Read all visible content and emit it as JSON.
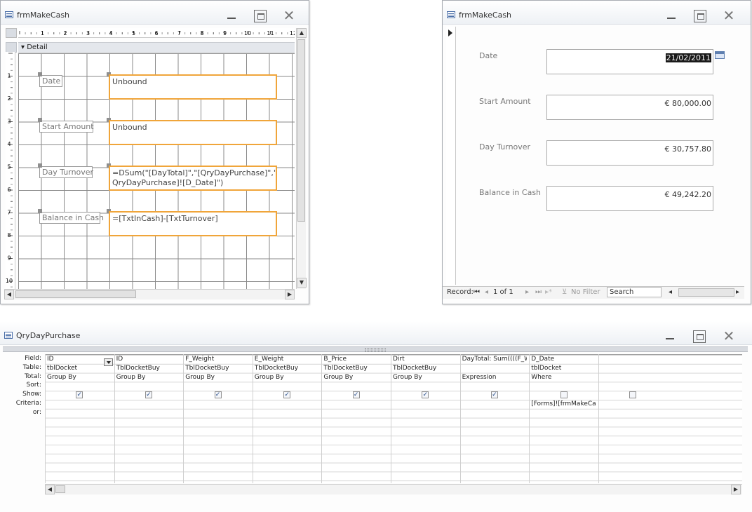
{
  "design_window": {
    "title": "frmMakeCash",
    "ruler_marks": [
      "1",
      "2",
      "3",
      "4",
      "5",
      "6",
      "7",
      "8",
      "9",
      "10",
      "11",
      "12"
    ],
    "vruler_marks": [
      "1",
      "2",
      "3",
      "4",
      "5",
      "6",
      "7",
      "8",
      "9",
      "10"
    ],
    "section": "Detail",
    "labels": [
      "Date",
      "Start Amount",
      "Day Turnover",
      "Balance in Cash"
    ],
    "controls": [
      "Unbound",
      "Unbound",
      "=DSum(\"[DayTotal]\",\"[QryDayPurchase]\",\"[",
      "=[TxtInCash]-[TxtTurnover]"
    ],
    "control3_line2": "QryDayPurchase]![D_Date]\")"
  },
  "form_window": {
    "title": "frmMakeCash",
    "fields": [
      {
        "label": "Date",
        "value": "21/02/2011"
      },
      {
        "label": "Start Amount",
        "value": "€ 80,000.00"
      },
      {
        "label": "Day Turnover",
        "value": "€ 30,757.80"
      },
      {
        "label": "Balance in Cash",
        "value": "€ 49,242.20"
      }
    ],
    "nav": {
      "record_label": "Record:",
      "position": "1 of 1",
      "filter": "No Filter",
      "search": "Search"
    }
  },
  "query_window": {
    "title": "QryDayPurchase",
    "row_headers": [
      "Field:",
      "Table:",
      "Total:",
      "Sort:",
      "Show:",
      "Criteria:",
      "or:"
    ],
    "columns": [
      {
        "field": "ID",
        "table": "tblDocket",
        "total": "Group By",
        "show": true,
        "criteria": ""
      },
      {
        "field": "ID",
        "table": "TblDocketBuy",
        "total": "Group By",
        "show": true,
        "criteria": ""
      },
      {
        "field": "F_Weight",
        "table": "TblDocketBuy",
        "total": "Group By",
        "show": true,
        "criteria": ""
      },
      {
        "field": "E_Weight",
        "table": "TblDocketBuy",
        "total": "Group By",
        "show": true,
        "criteria": ""
      },
      {
        "field": "B_Price",
        "table": "TblDocketBuy",
        "total": "Group By",
        "show": true,
        "criteria": ""
      },
      {
        "field": "Dirt",
        "table": "TblDocketBuy",
        "total": "Group By",
        "show": true,
        "criteria": ""
      },
      {
        "field": "DayTotal: Sum((((F_W",
        "table": "",
        "total": "Expression",
        "show": true,
        "criteria": ""
      },
      {
        "field": "D_Date",
        "table": "tblDocket",
        "total": "Where",
        "show": false,
        "criteria": "[Forms]![frmMakeCash]![TxtDate]"
      },
      {
        "field": "",
        "table": "",
        "total": "",
        "show": false,
        "criteria": ""
      }
    ]
  }
}
